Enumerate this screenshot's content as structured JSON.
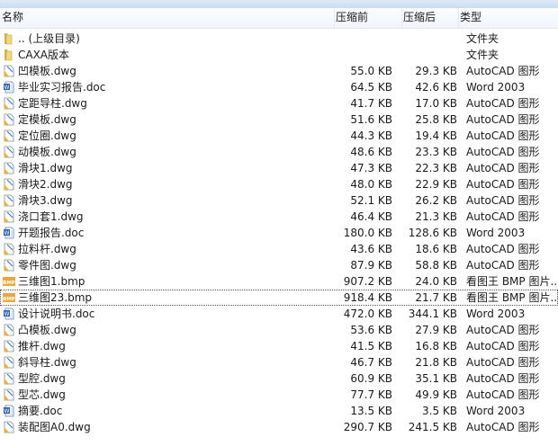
{
  "header": {
    "name": "名称",
    "before": "压缩前",
    "after": "压缩后",
    "type": "类型"
  },
  "files": [
    {
      "name": ".. (上级目录)",
      "before": "",
      "after": "",
      "type": "文件夹",
      "icon": "folder"
    },
    {
      "name": "CAXA版本",
      "before": "",
      "after": "",
      "type": "文件夹",
      "icon": "folder"
    },
    {
      "name": "凹模板.dwg",
      "before": "55.0 KB",
      "after": "29.3 KB",
      "type": "AutoCAD 图形",
      "icon": "dwg"
    },
    {
      "name": "毕业实习报告.doc",
      "before": "64.5 KB",
      "after": "42.6 KB",
      "type": "Word 2003",
      "icon": "doc"
    },
    {
      "name": "定距导柱.dwg",
      "before": "41.7 KB",
      "after": "17.0 KB",
      "type": "AutoCAD 图形",
      "icon": "dwg"
    },
    {
      "name": "定模板.dwg",
      "before": "51.6 KB",
      "after": "25.8 KB",
      "type": "AutoCAD 图形",
      "icon": "dwg"
    },
    {
      "name": "定位圈.dwg",
      "before": "44.3 KB",
      "after": "19.4 KB",
      "type": "AutoCAD 图形",
      "icon": "dwg"
    },
    {
      "name": "动模板.dwg",
      "before": "48.6 KB",
      "after": "23.3 KB",
      "type": "AutoCAD 图形",
      "icon": "dwg"
    },
    {
      "name": "滑块1.dwg",
      "before": "47.3 KB",
      "after": "22.3 KB",
      "type": "AutoCAD 图形",
      "icon": "dwg"
    },
    {
      "name": "滑块2.dwg",
      "before": "48.0 KB",
      "after": "22.9 KB",
      "type": "AutoCAD 图形",
      "icon": "dwg"
    },
    {
      "name": "滑块3.dwg",
      "before": "52.1 KB",
      "after": "26.2 KB",
      "type": "AutoCAD 图形",
      "icon": "dwg"
    },
    {
      "name": "浇口套1.dwg",
      "before": "46.4 KB",
      "after": "21.3 KB",
      "type": "AutoCAD 图形",
      "icon": "dwg"
    },
    {
      "name": "开题报告.doc",
      "before": "180.0 KB",
      "after": "128.6 KB",
      "type": "Word 2003",
      "icon": "doc"
    },
    {
      "name": "拉料杆.dwg",
      "before": "43.6 KB",
      "after": "18.6 KB",
      "type": "AutoCAD 图形",
      "icon": "dwg"
    },
    {
      "name": "零件图.dwg",
      "before": "87.9 KB",
      "after": "58.8 KB",
      "type": "AutoCAD 图形",
      "icon": "dwg"
    },
    {
      "name": "三维图1.bmp",
      "before": "907.2 KB",
      "after": "24.0 KB",
      "type": "看图王 BMP 图片...",
      "icon": "bmp"
    },
    {
      "name": "三维图23.bmp",
      "before": "918.4 KB",
      "after": "21.7 KB",
      "type": "看图王 BMP 图片...",
      "icon": "bmp"
    },
    {
      "name": "设计说明书.doc",
      "before": "472.0 KB",
      "after": "344.1 KB",
      "type": "Word 2003",
      "icon": "doc"
    },
    {
      "name": "凸模板.dwg",
      "before": "53.6 KB",
      "after": "27.9 KB",
      "type": "AutoCAD 图形",
      "icon": "dwg"
    },
    {
      "name": "推杆.dwg",
      "before": "41.5 KB",
      "after": "16.8 KB",
      "type": "AutoCAD 图形",
      "icon": "dwg"
    },
    {
      "name": "斜导柱.dwg",
      "before": "46.7 KB",
      "after": "21.8 KB",
      "type": "AutoCAD 图形",
      "icon": "dwg"
    },
    {
      "name": "型腔.dwg",
      "before": "60.9 KB",
      "after": "35.1 KB",
      "type": "AutoCAD 图形",
      "icon": "dwg"
    },
    {
      "name": "型芯.dwg",
      "before": "77.7 KB",
      "after": "49.9 KB",
      "type": "AutoCAD 图形",
      "icon": "dwg"
    },
    {
      "name": "摘要.doc",
      "before": "13.5 KB",
      "after": "3.5 KB",
      "type": "Word 2003",
      "icon": "doc"
    },
    {
      "name": "装配图A0.dwg",
      "before": "290.7 KB",
      "after": "241.5 KB",
      "type": "AutoCAD 图形",
      "icon": "dwg"
    }
  ],
  "focused_index": 16
}
